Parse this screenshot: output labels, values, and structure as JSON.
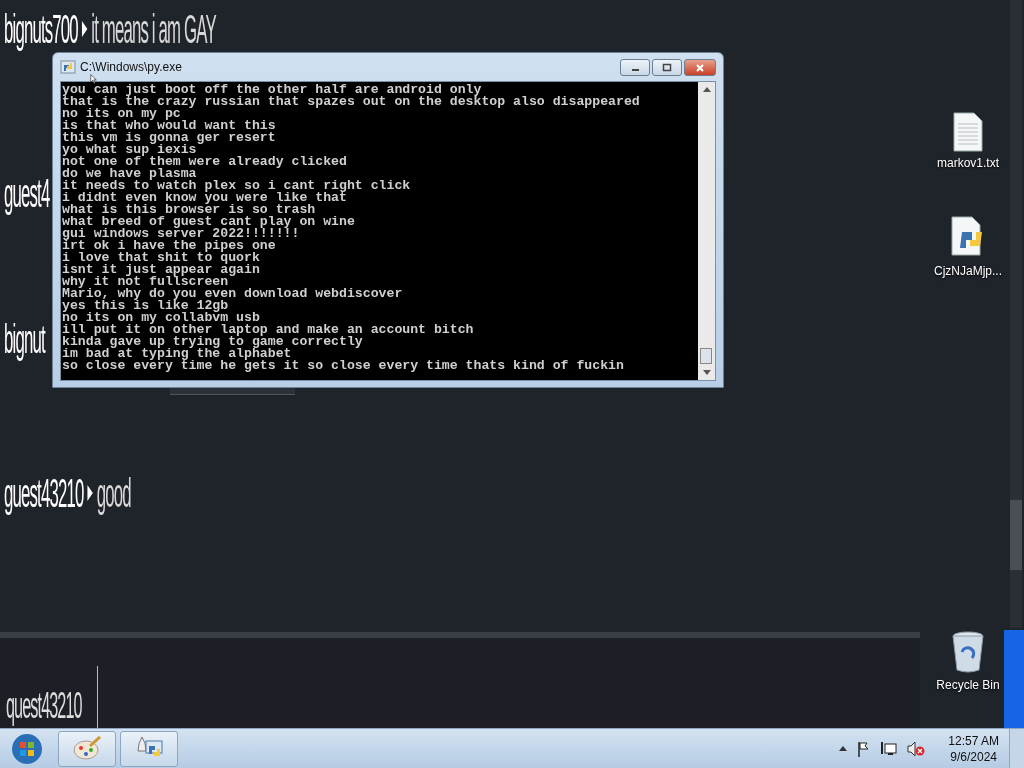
{
  "background_chat": {
    "messages": [
      {
        "user": "bignuts700",
        "text": "it means i am GAY"
      },
      {
        "user": "guest4"
      },
      {
        "user": "bignut"
      },
      {
        "user": "guest43210",
        "text": "good"
      }
    ],
    "input": {
      "user": "quest43210"
    }
  },
  "console_window": {
    "title": "C:\\Windows\\py.exe",
    "lines": [
      "you can just boot off the other half are android only",
      "that is the crazy russian that spazes out on the desktop also disappeared",
      "no its on my pc",
      "is that who would want this",
      "this vm is gonna ger resert",
      "yo what sup iexis",
      "not one of them were already clicked",
      "do we have plasma",
      "it needs to watch plex so i cant right click",
      "i didnt even know you were like that",
      "what is this browser is so trash",
      "what breed of guest cant play on wine",
      "gui windows server 2022!!!!!!!",
      "irt ok i have the pipes one",
      "i love that shit to quork",
      "isnt it just appear again",
      "why it not fullscreen",
      "Mario, why do you even download webdiscover",
      "yes this is like 12gb",
      "no its on my collabvm usb",
      "ill put it on other laptop and make an account bitch",
      "kinda gave up trying to game correctly",
      "im bad at typing the alphabet",
      "so close every time he gets it so close every time thats kind of fuckin"
    ]
  },
  "desktop_icons": [
    {
      "label": "markov1.txt",
      "kind": "text"
    },
    {
      "label": "CjzNJaMjp...",
      "kind": "python"
    },
    {
      "label": "Recycle Bin",
      "kind": "recycle"
    }
  ],
  "taskbar": {
    "buttons": [
      {
        "kind": "paint"
      },
      {
        "kind": "launcher"
      }
    ],
    "clock": {
      "time": "12:57 AM",
      "date": "9/6/2024"
    }
  }
}
